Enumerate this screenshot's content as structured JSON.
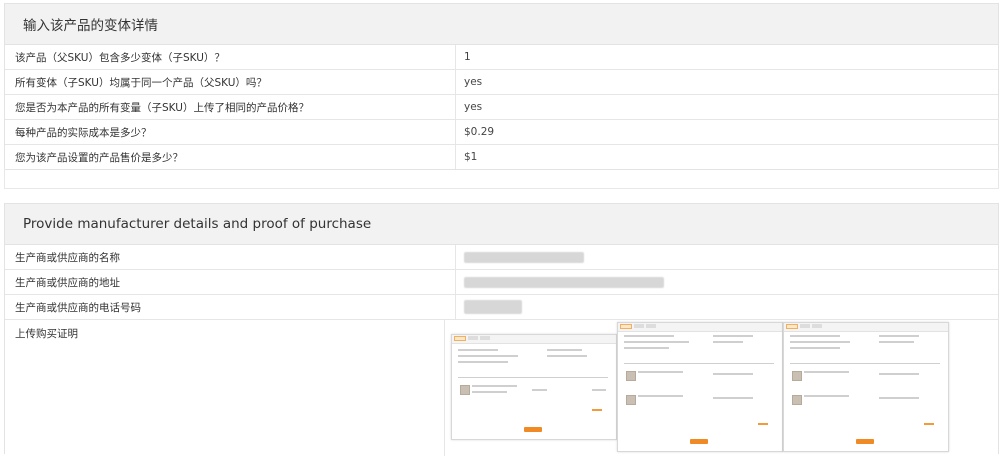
{
  "variants": {
    "title": "输入该产品的变体详情",
    "rows": [
      {
        "label": "该产品（父SKU）包含多少变体（子SKU）？",
        "value": "1"
      },
      {
        "label": "所有变体（子SKU）均属于同一个产品（父SKU）吗？",
        "value": "yes"
      },
      {
        "label": "您是否为本产品的所有变量（子SKU）上传了相同的产品价格？",
        "value": "yes"
      },
      {
        "label": "每种产品的实际成本是多少？",
        "value": "$0.29"
      },
      {
        "label": "您为该产品设置的产品售价是多少？",
        "value": "$1"
      }
    ]
  },
  "manufacturer": {
    "title": "Provide manufacturer details and proof of purchase",
    "rows": [
      {
        "label": "生产商或供应商的名称"
      },
      {
        "label": "生产商或供应商的地址"
      },
      {
        "label": "生产商或供应商的电话号码"
      }
    ],
    "proof_label": "上传购买证明",
    "thumbnails": [
      "receipt-image-1",
      "receipt-image-2",
      "receipt-image-3"
    ]
  },
  "colors": {
    "accent": "#f08a24",
    "header_bg": "#f2f2f2",
    "border": "#e3e3e3"
  }
}
